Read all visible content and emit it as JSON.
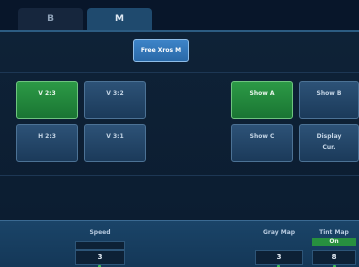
{
  "tabs": [
    {
      "label": "B",
      "active": false
    },
    {
      "label": "M",
      "active": true
    }
  ],
  "panel": {
    "free_xros_button": "Free Xros M",
    "layout_buttons": {
      "v23": "V 2:3",
      "v32": "V 3:2",
      "h23": "H 2:3",
      "v31": "V 3:1"
    },
    "show_buttons": {
      "show_a": "Show A",
      "show_b": "Show B",
      "show_c": "Show C",
      "display_cur_line1": "Display",
      "display_cur_line2": "Cur."
    }
  },
  "bottom": {
    "speed": {
      "label": "Speed",
      "value": "3"
    },
    "gray_map": {
      "label": "Gray Map",
      "value": "3"
    },
    "tint_map": {
      "label": "Tint Map",
      "status": "On",
      "value": "8"
    }
  },
  "colors": {
    "active_green": "#2c9a46",
    "accent_blue": "#3d84c8"
  }
}
